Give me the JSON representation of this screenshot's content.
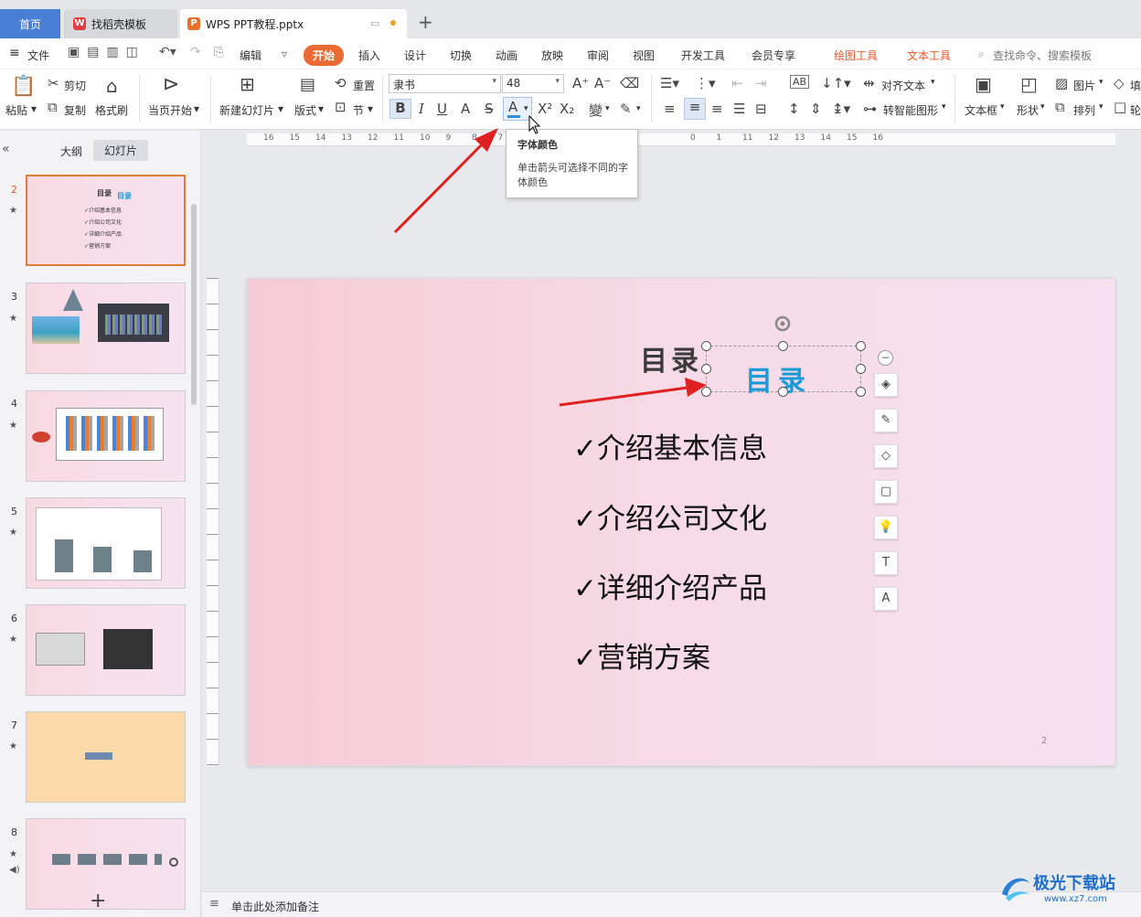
{
  "tabs": {
    "home": "首页",
    "daoke": "找稻壳模板",
    "file": "WPS PPT教程.pptx",
    "new_tab": "+"
  },
  "menu": {
    "file": "文件",
    "edit": "编辑",
    "start": "开始",
    "insert": "插入",
    "design": "设计",
    "switch": "切换",
    "animation": "动画",
    "show": "放映",
    "review": "审阅",
    "view": "视图",
    "dev": "开发工具",
    "vip": "会员专享",
    "draw_tools": "绘图工具",
    "text_tools": "文本工具",
    "search": "查找命令、搜索模板"
  },
  "ribbon": {
    "paste": "粘贴",
    "cut": "剪切",
    "copy": "复制",
    "format_painter": "格式刷",
    "from_current": "当页开始",
    "new_slide": "新建幻灯片",
    "layout": "版式",
    "reset": "重置",
    "section": "节",
    "font_name": "隶书",
    "font_size": "48",
    "align_text": "对齐文本",
    "smart_shape": "转智能图形",
    "textbox": "文本框",
    "shape": "形状",
    "picture": "图片",
    "arrange": "排列",
    "fill": "填",
    "outline": "轮"
  },
  "tooltip": {
    "title": "字体颜色",
    "desc": "单击箭头可选择不同的字体颜色"
  },
  "panel": {
    "outline": "大纲",
    "slides": "幻灯片",
    "add": "+"
  },
  "thumbs": [
    {
      "num": "2",
      "title": "目录",
      "items": [
        "✓介绍基本信息",
        "✓介绍公司文化",
        "✓详细介绍产品",
        "✓营销方案"
      ]
    },
    {
      "num": "3"
    },
    {
      "num": "4"
    },
    {
      "num": "5"
    },
    {
      "num": "6"
    },
    {
      "num": "7"
    },
    {
      "num": "8"
    }
  ],
  "slide": {
    "title_black": "目录",
    "title_blue": "目录",
    "items": [
      "✓介绍基本信息",
      "✓介绍公司文化",
      "✓详细介绍产品",
      "✓营销方案"
    ],
    "page": "2"
  },
  "notes": "单击此处添加备注",
  "ruler": {
    "top": [
      "16",
      "15",
      "14",
      "13",
      "12",
      "11",
      "10",
      "9",
      "8",
      "7",
      "0",
      "1",
      "11",
      "12",
      "13",
      "14",
      "15",
      "16"
    ]
  },
  "watermark": {
    "name": "极光下载站",
    "url": "www.xz7.com"
  },
  "colors": {
    "accent": "#ea6a34",
    "tab_home": "#4a7fd6",
    "title_blue": "#1a9ad6",
    "arrow_red": "#e02020"
  }
}
